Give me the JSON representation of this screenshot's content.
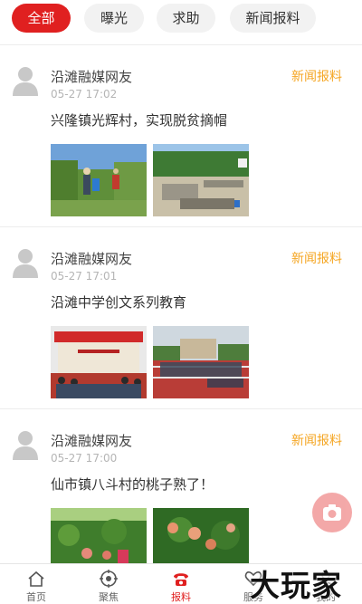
{
  "filter_tabs": [
    {
      "label": "全部",
      "active": true
    },
    {
      "label": "曝光",
      "active": false
    },
    {
      "label": "求助",
      "active": false
    },
    {
      "label": "新闻报料",
      "active": false
    }
  ],
  "posts": [
    {
      "author": "沿滩融媒网友",
      "time": "05-27 17:02",
      "tag": "新闻报料",
      "title": "兴隆镇光辉村，实现脱贫摘帽"
    },
    {
      "author": "沿滩融媒网友",
      "time": "05-27 17:01",
      "tag": "新闻报料",
      "title": "沿滩中学创文系列教育"
    },
    {
      "author": "沿滩融媒网友",
      "time": "05-27 17:00",
      "tag": "新闻报料",
      "title": "仙市镇八斗村的桃子熟了！"
    }
  ],
  "bottom_nav": [
    {
      "label": "首页",
      "icon": "home-icon",
      "active": false
    },
    {
      "label": "聚焦",
      "icon": "focus-icon",
      "active": false
    },
    {
      "label": "报料",
      "icon": "phone-icon",
      "active": true
    },
    {
      "label": "服务",
      "icon": "heart-icon",
      "active": false
    },
    {
      "label": "我的",
      "icon": "user-icon",
      "active": false
    }
  ],
  "fab": {
    "icon": "camera-icon"
  },
  "watermark": "大玩家",
  "colors": {
    "accent": "#e02020",
    "tag": "#f5a623",
    "time": "#b5b5b5"
  }
}
